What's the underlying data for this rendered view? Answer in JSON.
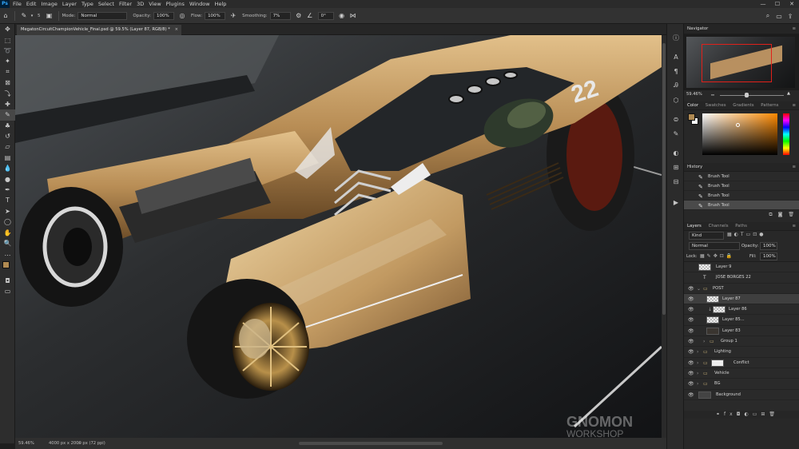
{
  "app": {
    "logo": "Ps"
  },
  "menu": [
    "File",
    "Edit",
    "Image",
    "Layer",
    "Type",
    "Select",
    "Filter",
    "3D",
    "View",
    "Plugins",
    "Window",
    "Help"
  ],
  "window_controls": {
    "minimize": "—",
    "maximize": "☐",
    "close": "✕"
  },
  "options": {
    "brush_size": "5",
    "mode_label": "Mode:",
    "mode_value": "Normal",
    "opacity_label": "Opacity:",
    "opacity_value": "100%",
    "flow_label": "Flow:",
    "flow_value": "100%",
    "smoothing_label": "Smoothing:",
    "smoothing_value": "7%",
    "angle_value": "0°"
  },
  "document": {
    "tab_title": "MegatonCircuitChampionVehicle_Final.psd @ 59.5% (Layer 87, RGB/8) *",
    "close": "×",
    "car_number": "22"
  },
  "status": {
    "zoom": "59.46%",
    "dimensions": "4000 px x 2000 px (72 ppi)",
    "arrow": ">"
  },
  "navigator": {
    "title": "Navigator",
    "zoom": "59.46%"
  },
  "color_panel": {
    "tabs": [
      "Color",
      "Swatches",
      "Gradients",
      "Patterns"
    ],
    "fg_color": "#b08a52",
    "bg_color": "#ffffff",
    "hue_color": "#ff8a00"
  },
  "history": {
    "title": "History",
    "items": [
      "Brush Tool",
      "Brush Tool",
      "Brush Tool",
      "Brush Tool"
    ]
  },
  "layers_panel": {
    "tabs": [
      "Layers",
      "Channels",
      "Paths"
    ],
    "filter_kind": "Kind",
    "blend_mode": "Normal",
    "opacity_label": "Opacity:",
    "opacity_value": "100%",
    "lock_label": "Lock:",
    "fill_label": "Fill:",
    "fill_value": "100%",
    "layers": [
      {
        "name": "Layer 9",
        "kind": "layer"
      },
      {
        "name": "JOSE BORGES 22",
        "kind": "text"
      },
      {
        "name": "POST",
        "kind": "group"
      },
      {
        "name": "Layer 87",
        "kind": "layer"
      },
      {
        "name": "Layer 86",
        "kind": "layer"
      },
      {
        "name": "Layer 85...",
        "kind": "layer"
      },
      {
        "name": "Layer 83",
        "kind": "layer"
      },
      {
        "name": "Group 1",
        "kind": "group"
      },
      {
        "name": "Lighting",
        "kind": "group"
      },
      {
        "name": "Conflict",
        "kind": "layer"
      },
      {
        "name": "Vehicle",
        "kind": "group"
      },
      {
        "name": "BG",
        "kind": "group"
      },
      {
        "name": "Background",
        "kind": "layer"
      }
    ]
  },
  "watermark": {
    "line1": "GNOMON",
    "line2": "WORKSHOP"
  }
}
